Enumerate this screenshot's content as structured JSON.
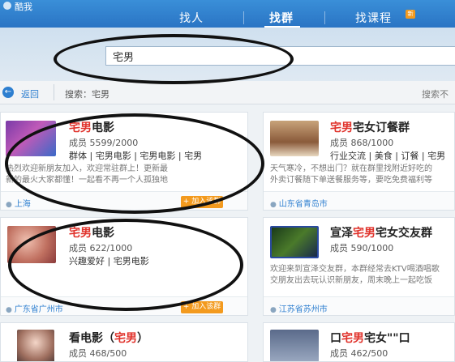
{
  "app": {
    "title": "酷我"
  },
  "nav": {
    "tabs": [
      {
        "label": "找人",
        "active": false
      },
      {
        "label": "找群",
        "active": true
      },
      {
        "label": "找课程",
        "active": false
      }
    ],
    "new_badge": "新"
  },
  "search": {
    "value": "宅男"
  },
  "breadcrumb": {
    "back_label": "返回",
    "search_label": "搜索：宅男",
    "right_text": "搜索不"
  },
  "groups": [
    {
      "title_hl": "宅男",
      "title_rest": "电影",
      "members": "成员 5599/2000",
      "tags": [
        "群体",
        "宅男电影",
        "宅男电影",
        "宅男"
      ],
      "desc": [
        "热烈欢迎新朋友加入，欢迎常驻群上！更新最",
        "新的最火大家都懂！一起看不再一个人孤独地"
      ],
      "location": "上海"
    },
    {
      "title_hl": "宅男",
      "title_rest": "宅女订餐群",
      "members": "成员 868/1000",
      "tags": [
        "行业交流",
        "美食",
        "订餐",
        "宅男"
      ],
      "desc": [
        "天气寒冷，不想出门？就在群里找附近好吃的",
        "外卖订餐随下单送餐服务等，要吃免费福利等"
      ],
      "location": "山东省青岛市"
    },
    {
      "title_hl": "宅男",
      "title_rest": "电影",
      "members": "成员 622/1000",
      "tags": [
        "兴趣爱好",
        "宅男电影"
      ],
      "desc": [],
      "location": "广东省广州市"
    },
    {
      "title_pre": "宣泽",
      "title_hl": "宅男",
      "title_rest": "宅女交友群",
      "members": "成员 590/1000",
      "tags": [],
      "desc": [
        "欢迎来到宣泽交友群，本群经常去KTV喝酒唱歌",
        "交朋友出去玩认识新朋友，周末晚上一起吃饭"
      ],
      "location": "江苏省苏州市"
    },
    {
      "title_pre": "看电影（",
      "title_hl": "宅男",
      "title_rest": "）",
      "members": "成员 468/500",
      "tags": [],
      "desc": [],
      "location": ""
    },
    {
      "title_pre": "口",
      "title_hl": "宅男",
      "title_rest": "宅女\"\"口",
      "members": "成员 462/500",
      "tags": [],
      "desc": [],
      "location": ""
    }
  ],
  "join_label": "+ 加入该群",
  "colors": {
    "accent": "#2a74c4",
    "highlight": "#e0322b",
    "join": "#f39a1e"
  }
}
